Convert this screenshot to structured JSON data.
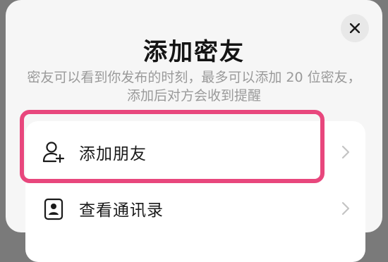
{
  "dialog": {
    "title": "添加密友",
    "subtitle_line1": "密友可以看到你发布的时刻，最多可以添加 20 位密友，",
    "subtitle_line2": "添加后对方会收到提醒",
    "close_icon": "close-icon"
  },
  "options": [
    {
      "label": "添加朋友",
      "icon": "add-friend-icon"
    },
    {
      "label": "查看通讯录",
      "icon": "contacts-icon"
    }
  ],
  "colors": {
    "highlight": "#e8477d",
    "background_overlay": "#7a7a7a",
    "sheet": "#f6f6f6"
  }
}
